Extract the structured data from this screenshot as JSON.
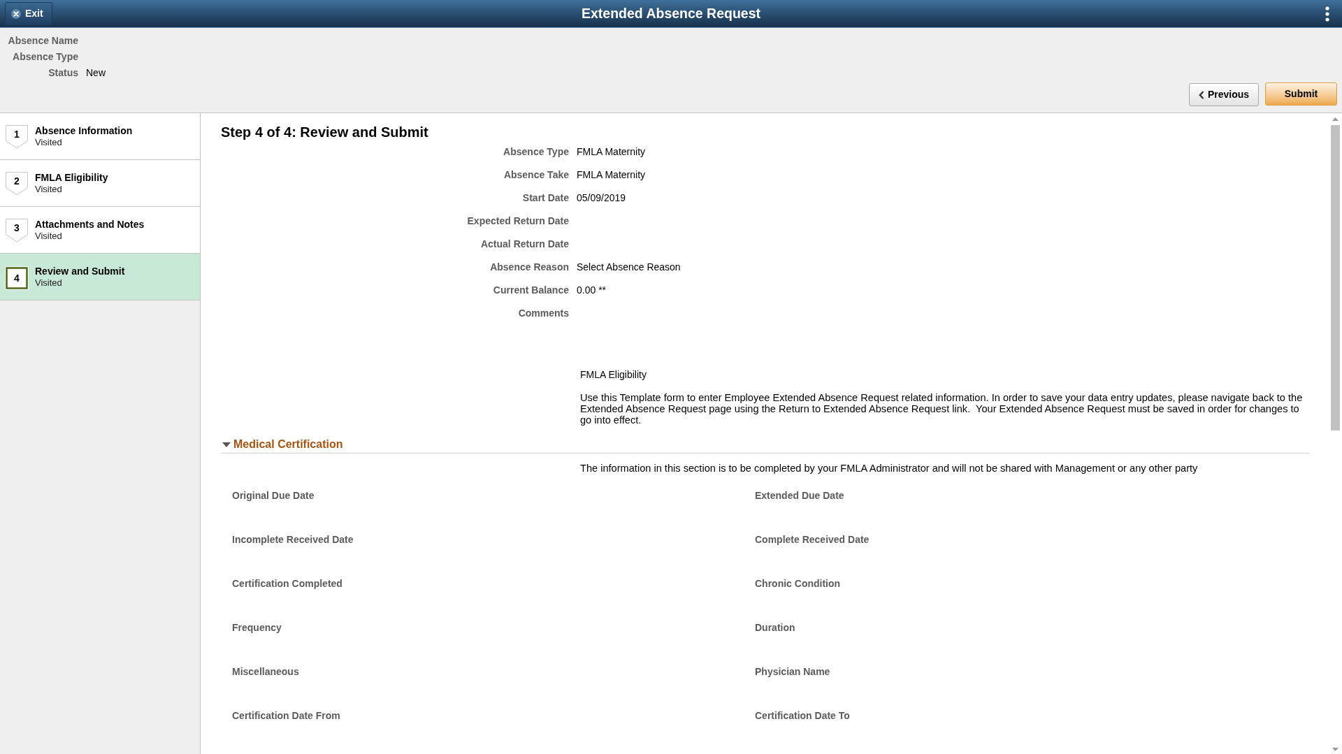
{
  "header": {
    "exit_label": "Exit",
    "title": "Extended Absence Request"
  },
  "summary": [
    {
      "label": "Absence Name"
    },
    {
      "label": "Absence Type"
    },
    {
      "label": "Status",
      "value": "New"
    }
  ],
  "actions": [
    {
      "kind": "previous",
      "label": "Previous"
    },
    {
      "kind": "primary",
      "label": "Submit"
    }
  ],
  "steps": [
    {
      "number": "1",
      "title": "Absence Information",
      "status": "Visited",
      "selected": false
    },
    {
      "number": "2",
      "title": "FMLA Eligibility",
      "status": "Visited",
      "selected": false
    },
    {
      "number": "3",
      "title": "Attachments and Notes",
      "status": "Visited",
      "selected": false
    },
    {
      "number": "4",
      "title": "Review and Submit",
      "status": "Visited",
      "selected": true
    }
  ],
  "review": {
    "heading": "Step 4 of 4: Review and Submit",
    "fields": [
      {
        "label": "Absence Type",
        "value": "FMLA Maternity"
      },
      {
        "label": "Absence Take",
        "value": "FMLA Maternity"
      },
      {
        "label": "Start Date",
        "value": "05/09/2019"
      },
      {
        "label": "Expected Return Date"
      },
      {
        "label": "Actual Return Date"
      },
      {
        "label": "Absence Reason",
        "value": "Select Absence Reason"
      },
      {
        "label": "Current Balance",
        "value": "0.00 **"
      },
      {
        "label": "Comments"
      }
    ],
    "eligibility_title": "FMLA Eligibility",
    "eligibility_text": "Use this Template form to enter Employee Extended Absence Request related information. In order to save your data entry updates, please navigate back to the Extended Absence Request page using the Return to Extended Absence Request link.  Your Extended Absence Request must be saved in order for changes to go into effect.",
    "section": {
      "title": "Medical Certification",
      "expanded": true,
      "note": "The information in this section is to be completed by your FMLA Administrator and will not be shared with Management or any other party",
      "fields": [
        "Original Due Date",
        "Extended Due Date",
        "Incomplete Received Date",
        "Complete Received Date",
        "Certification Completed",
        "Chronic Condition",
        "Frequency",
        "Duration",
        "Miscellaneous",
        "Physician Name",
        "Certification Date From",
        "Certification Date To"
      ]
    }
  }
}
